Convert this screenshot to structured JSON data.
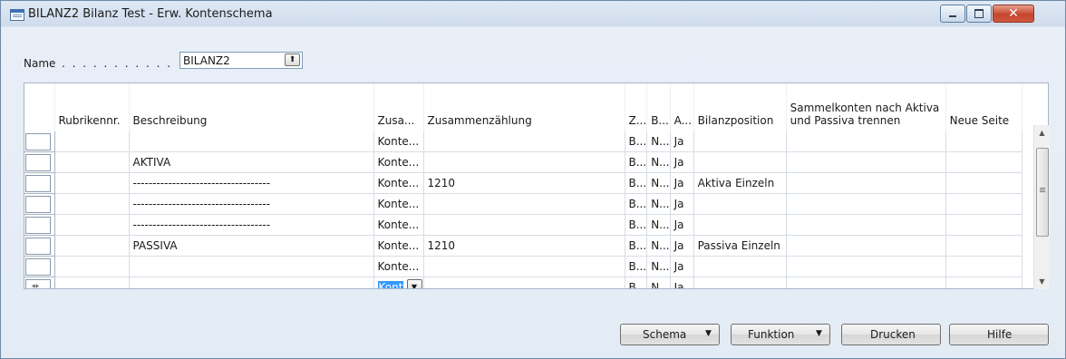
{
  "window": {
    "title": "BILANZ2 Bilanz Test - Erw. Kontenschema"
  },
  "name_field": {
    "label": "Name",
    "dots": ". . . . . . . . . . .",
    "value": "BILANZ2"
  },
  "grid": {
    "columns": [
      "",
      "Rubrikennr.",
      "Beschreibung",
      "Zusa...",
      "Zusammenzählung",
      "Z...",
      "B...",
      "A...",
      "Bilanzposition",
      "Sammelkonten nach Aktiva und Passiva trennen",
      "Neue Seite"
    ],
    "rows": [
      {
        "marker": "",
        "rubrik": "",
        "beschreibung": "",
        "zusa": "Konte...",
        "zusammen": "",
        "z": "B...",
        "b": "N...",
        "a": "Ja",
        "bilanzpos": "",
        "sammel": "",
        "neue_seite": ""
      },
      {
        "marker": "",
        "rubrik": "",
        "beschreibung": "AKTIVA",
        "zusa": "Konte...",
        "zusammen": "",
        "z": "B...",
        "b": "N...",
        "a": "Ja",
        "bilanzpos": "",
        "sammel": "",
        "neue_seite": ""
      },
      {
        "marker": "",
        "rubrik": "",
        "beschreibung": "-----------------------------------",
        "zusa": "Konte...",
        "zusammen": "1210",
        "z": "B...",
        "b": "N...",
        "a": "Ja",
        "bilanzpos": "Aktiva Einzeln",
        "sammel": "",
        "neue_seite": ""
      },
      {
        "marker": "",
        "rubrik": "",
        "beschreibung": "-----------------------------------",
        "zusa": "Konte...",
        "zusammen": "",
        "z": "B...",
        "b": "N...",
        "a": "Ja",
        "bilanzpos": "",
        "sammel": "",
        "neue_seite": ""
      },
      {
        "marker": "",
        "rubrik": "",
        "beschreibung": "-----------------------------------",
        "zusa": "Konte...",
        "zusammen": "",
        "z": "B...",
        "b": "N...",
        "a": "Ja",
        "bilanzpos": "",
        "sammel": "",
        "neue_seite": ""
      },
      {
        "marker": "",
        "rubrik": "",
        "beschreibung": "PASSIVA",
        "zusa": "Konte...",
        "zusammen": "1210",
        "z": "B...",
        "b": "N...",
        "a": "Ja",
        "bilanzpos": "Passiva Einzeln",
        "sammel": "",
        "neue_seite": ""
      },
      {
        "marker": "",
        "rubrik": "",
        "beschreibung": "",
        "zusa": "Konte...",
        "zusammen": "",
        "z": "B...",
        "b": "N...",
        "a": "Ja",
        "bilanzpos": "",
        "sammel": "",
        "neue_seite": ""
      },
      {
        "marker": "**",
        "rubrik": "",
        "beschreibung": "",
        "zusa": "Kont",
        "zusammen": "",
        "z": "B...",
        "b": "N...",
        "a": "Ja",
        "bilanzpos": "",
        "sammel": "",
        "neue_seite": ""
      }
    ]
  },
  "buttons": {
    "schema": "Schema",
    "funktion": "Funktion",
    "drucken": "Drucken",
    "hilfe": "Hilfe"
  },
  "icons": {
    "app": "form-window-icon",
    "minimize": "minimize-icon",
    "maximize": "maximize-icon",
    "close": "close-icon",
    "lookup": "lookup-arrow-up-icon",
    "dropdown": "chevron-down-icon",
    "scroll_up": "scroll-up-arrow-icon",
    "scroll_down": "scroll-down-arrow-icon"
  },
  "colors": {
    "selection": "#3399ff",
    "close_button": "#c4452c"
  }
}
